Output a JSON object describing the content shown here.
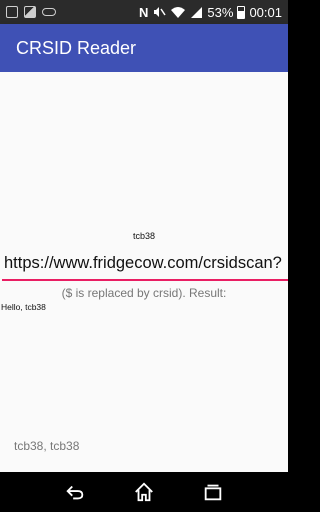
{
  "status_bar": {
    "battery": "53%",
    "time": "00:01",
    "icons": [
      "sim-icon",
      "image-icon",
      "voicemail-icon",
      "nfc-icon",
      "mute-icon",
      "wifi-icon",
      "signal-icon",
      "battery-icon"
    ]
  },
  "app_bar": {
    "title": "CRSID Reader"
  },
  "main": {
    "crsid": "tcb38",
    "url_value": "https://www.fridgecow.com/crsidscan?",
    "hint": "($ is replaced by crsid). Result:",
    "result": "Hello, tcb38",
    "footer": "tcb38, tcb38"
  },
  "nav_bar": {
    "icons": [
      "back-icon",
      "home-icon",
      "recents-icon"
    ]
  },
  "colors": {
    "app_bar": "#3f51b5",
    "accent": "#e91e63",
    "status_bar": "#2b2b2b"
  }
}
